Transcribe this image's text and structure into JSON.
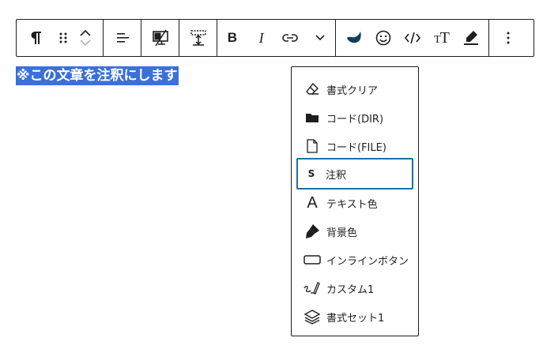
{
  "toolbar": {
    "paragraph_icon": "paragraph-icon",
    "bold_label": "B",
    "italic_label": "I",
    "text_size_label": "TT"
  },
  "content": {
    "selected_text": "※この文章を注釈にします"
  },
  "format_menu": {
    "items": [
      {
        "label": "書式クリア",
        "icon": "eraser-icon"
      },
      {
        "label": "コード(DIR)",
        "icon": "folder-icon"
      },
      {
        "label": "コード(FILE)",
        "icon": "file-icon"
      },
      {
        "label": "注釈",
        "icon": "s-icon",
        "icon_text": "S",
        "active": true
      },
      {
        "label": "テキスト色",
        "icon": "text-color-icon",
        "icon_text": "A"
      },
      {
        "label": "背景色",
        "icon": "paint-brush-icon"
      },
      {
        "label": "インラインボタン",
        "icon": "button-icon"
      },
      {
        "label": "カスタム1",
        "icon": "pen-signature-icon"
      },
      {
        "label": "書式セット1",
        "icon": "layers-icon"
      }
    ]
  },
  "colors": {
    "selection": "#3a70d8",
    "active_border": "#1f6f9b",
    "border": "#1e1e1e",
    "accent_icon": "#0f3f5b"
  }
}
